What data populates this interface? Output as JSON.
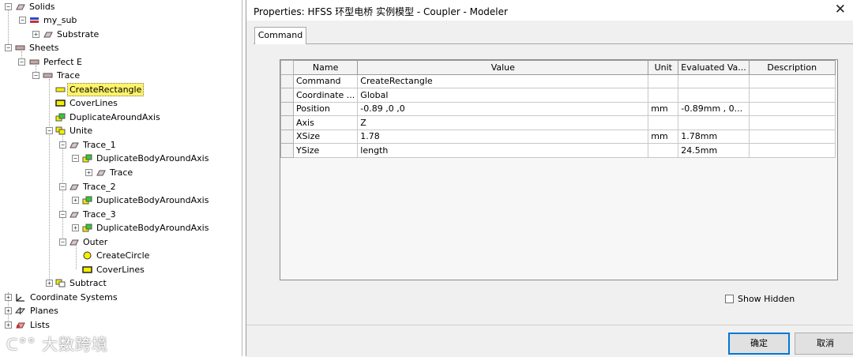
{
  "tree": {
    "solids": "Solids",
    "my_sub": "my_sub",
    "substrate": "Substrate",
    "sheets": "Sheets",
    "perfect_e": "Perfect E",
    "trace": "Trace",
    "create_rectangle": "CreateRectangle",
    "cover_lines_1": "CoverLines",
    "duplicate_around_axis": "DuplicateAroundAxis",
    "unite": "Unite",
    "trace_1": "Trace_1",
    "dup_body_1": "DuplicateBodyAroundAxis",
    "trace_inner": "Trace",
    "trace_2": "Trace_2",
    "dup_body_2": "DuplicateBodyAroundAxis",
    "trace_3": "Trace_3",
    "dup_body_3": "DuplicateBodyAroundAxis",
    "outer": "Outer",
    "create_circle": "CreateCircle",
    "cover_lines_2": "CoverLines",
    "subtract": "Subtract",
    "coordinate_systems": "Coordinate Systems",
    "planes": "Planes",
    "lists": "Lists"
  },
  "watermark": "大数跨境",
  "dialog": {
    "title": "Properties: HFSS 环型电桥 实例模型 - Coupler - Modeler",
    "close_glyph": "✕",
    "tab": "Command",
    "columns": [
      "Name",
      "Value",
      "Unit",
      "Evaluated Va...",
      "Description"
    ],
    "rows": [
      [
        "Command",
        "CreateRectangle",
        "",
        "",
        ""
      ],
      [
        "Coordinate ...",
        "Global",
        "",
        "",
        ""
      ],
      [
        "Position",
        "-0.89 ,0 ,0",
        "mm",
        "-0.89mm , 0...",
        ""
      ],
      [
        "Axis",
        "Z",
        "",
        "",
        ""
      ],
      [
        "XSize",
        "1.78",
        "mm",
        "1.78mm",
        ""
      ],
      [
        "YSize",
        "length",
        "",
        "24.5mm",
        ""
      ]
    ],
    "show_hidden": "Show Hidden",
    "ok": "确定",
    "cancel": "取消"
  },
  "colors": {
    "selection": "#fff36b",
    "solid_icon": "#c93030",
    "sheet_icon": "#c9a7a7",
    "green_op": "#36c936",
    "yellow_op": "#f4f000"
  }
}
